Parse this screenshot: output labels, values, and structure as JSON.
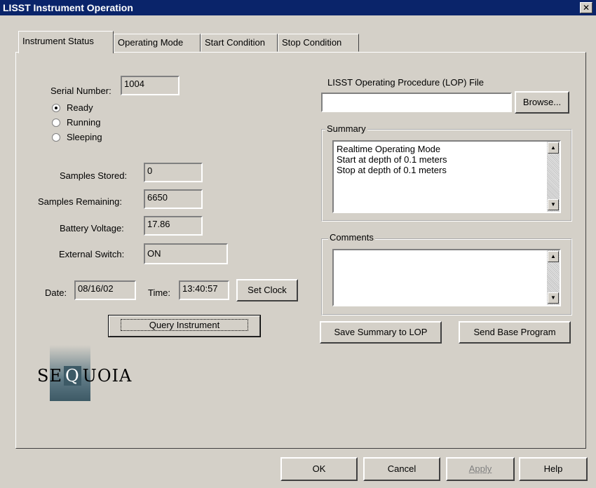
{
  "window": {
    "title": "LISST Instrument Operation",
    "close_label": "✕"
  },
  "tabs": [
    {
      "label": "Instrument Status"
    },
    {
      "label": "Operating Mode"
    },
    {
      "label": "Start Condition"
    },
    {
      "label": "Stop Condition"
    }
  ],
  "status": {
    "serial_label": "Serial Number:",
    "serial_value": "1004",
    "states": [
      {
        "label": "Ready",
        "checked": true
      },
      {
        "label": "Running",
        "checked": false
      },
      {
        "label": "Sleeping",
        "checked": false
      }
    ],
    "samples_stored_label": "Samples Stored:",
    "samples_stored_value": "0",
    "samples_remaining_label": "Samples Remaining:",
    "samples_remaining_value": "6650",
    "battery_label": "Battery Voltage:",
    "battery_value": "17.86",
    "switch_label": "External Switch:",
    "switch_value": "ON",
    "date_label": "Date:",
    "date_value": "08/16/02",
    "time_label": "Time:",
    "time_value": "13:40:57",
    "set_clock_label": "Set Clock",
    "query_label": "Query Instrument"
  },
  "lop": {
    "label": "LISST Operating Procedure (LOP) File",
    "file_value": "",
    "browse_label": "Browse..."
  },
  "summary": {
    "legend": "Summary",
    "lines": [
      "Realtime Operating Mode",
      "Start at depth of 0.1 meters",
      "Stop at depth of 0.1 meters"
    ]
  },
  "comments": {
    "legend": "Comments",
    "value": ""
  },
  "actions": {
    "save_summary_label": "Save Summary to LOP",
    "send_base_label": "Send Base Program"
  },
  "logo": {
    "text_left": "SE",
    "text_q": "Q",
    "text_right": "UOIA",
    "accent_color": "#3d5a66"
  },
  "footer": {
    "ok_label": "OK",
    "cancel_label": "Cancel",
    "apply_label": "Apply",
    "help_label": "Help"
  },
  "icons": {
    "scroll_up": "▲",
    "scroll_down": "▼"
  }
}
